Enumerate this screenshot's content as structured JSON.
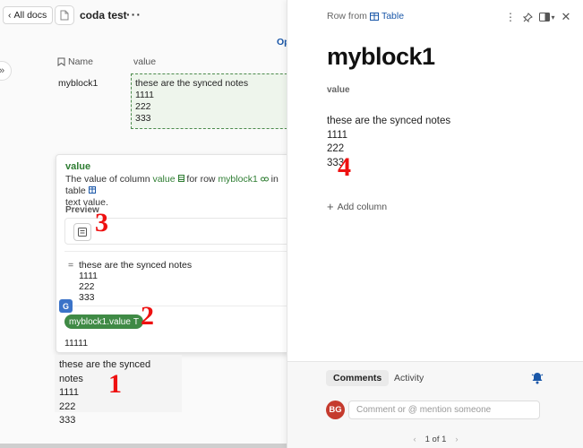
{
  "header": {
    "back_label": "All docs",
    "doc_title": "coda test",
    "more": "···",
    "op_link": "Op"
  },
  "table": {
    "col_name": "Name",
    "col_value": "value",
    "row": {
      "name": "myblock1",
      "value_lines": [
        "these are the synced notes",
        "1111",
        "222",
        "333"
      ]
    }
  },
  "popup": {
    "title": "value",
    "desc_prefix": "The value of column ",
    "desc_col": "value",
    "desc_mid": " for row ",
    "desc_row": "myblock1",
    "desc_suffix": " in table",
    "desc_line2": "text value.",
    "preview_label": "Preview",
    "list_eq": "=",
    "list_lines": [
      "these are the synced notes",
      "1111",
      "222",
      "333"
    ],
    "translate_icon": "G",
    "formula_chip": "myblock1.value",
    "formula_type": "T",
    "result": "11111"
  },
  "bottom_text": [
    "these are the synced notes",
    "1111",
    "222",
    "333"
  ],
  "annotations": [
    "1",
    "2",
    "3",
    "4"
  ],
  "panel": {
    "row_from": "Row from",
    "table_link": "Table",
    "title": "myblock1",
    "field_label": "value",
    "field_lines": [
      "these are the synced notes",
      "1111",
      "222",
      "333"
    ],
    "add_column": "Add column",
    "tab_comments": "Comments",
    "tab_activity": "Activity",
    "avatar": "BG",
    "comment_placeholder": "Comment or @ mention someone",
    "pager": "1 of 1",
    "pager_prev": "‹",
    "pager_next": "›"
  },
  "colors": {
    "accent_green": "#2e7d32",
    "link_blue": "#1a57a8",
    "annotation_red": "#ee1111",
    "avatar_red": "#c53b2e"
  }
}
